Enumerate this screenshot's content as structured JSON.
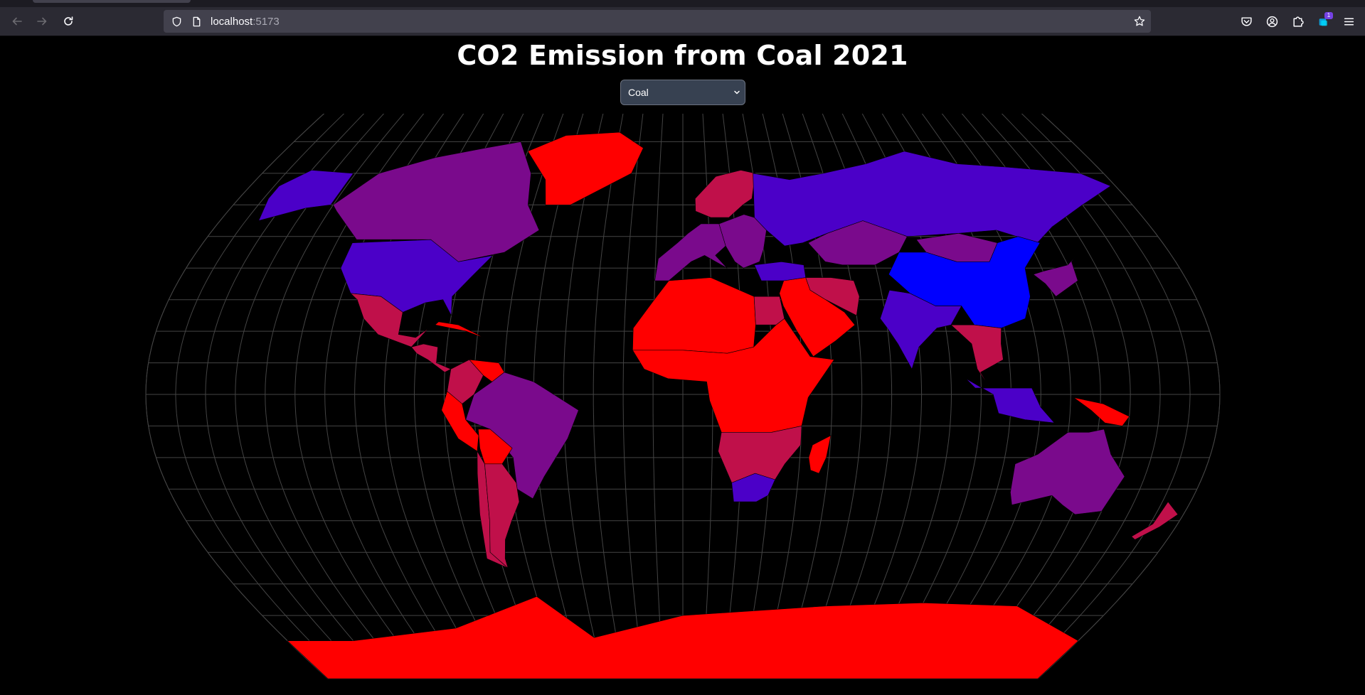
{
  "browser": {
    "url_host": "localhost",
    "url_port": ":5173",
    "extension_badge": "1",
    "icons": {
      "back": "arrow-left-icon",
      "forward": "arrow-right-icon",
      "reload": "reload-icon",
      "shield": "shield-icon",
      "page": "page-icon",
      "bookmark": "star-icon",
      "pocket": "pocket-icon",
      "account": "account-icon",
      "extensions": "puzzle-icon",
      "extension": "extension-icon",
      "menu": "hamburger-menu-icon"
    }
  },
  "page": {
    "title": "CO2 Emission from Coal 2021",
    "fuel_select": {
      "selected": "Coal"
    }
  },
  "map": {
    "projection": "robinson-like",
    "graticule": true,
    "colors": {
      "background": "#000000",
      "graticule": "#444444",
      "border": "#000000",
      "high": "#0000ff",
      "upper_mid": "#4b00c8",
      "mid": "#7a0a8c",
      "lower_mid": "#c0104a",
      "low": "#ff0000"
    },
    "regions": [
      {
        "name": "Canada",
        "level": "mid"
      },
      {
        "name": "United States",
        "level": "upper_mid"
      },
      {
        "name": "Alaska",
        "level": "upper_mid"
      },
      {
        "name": "Greenland",
        "level": "low"
      },
      {
        "name": "Mexico",
        "level": "lower_mid"
      },
      {
        "name": "Central America",
        "level": "lower_mid"
      },
      {
        "name": "Caribbean",
        "level": "low"
      },
      {
        "name": "Colombia",
        "level": "lower_mid"
      },
      {
        "name": "Venezuela",
        "level": "low"
      },
      {
        "name": "Brazil",
        "level": "mid"
      },
      {
        "name": "Peru",
        "level": "low"
      },
      {
        "name": "Bolivia",
        "level": "low"
      },
      {
        "name": "Chile",
        "level": "lower_mid"
      },
      {
        "name": "Argentina",
        "level": "lower_mid"
      },
      {
        "name": "Western Europe",
        "level": "mid"
      },
      {
        "name": "Scandinavia",
        "level": "lower_mid"
      },
      {
        "name": "Eastern Europe",
        "level": "mid"
      },
      {
        "name": "Russia",
        "level": "upper_mid"
      },
      {
        "name": "Kazakhstan",
        "level": "mid"
      },
      {
        "name": "Mongolia",
        "level": "mid"
      },
      {
        "name": "China",
        "level": "high"
      },
      {
        "name": "India",
        "level": "upper_mid"
      },
      {
        "name": "Middle East",
        "level": "low"
      },
      {
        "name": "Iran",
        "level": "lower_mid"
      },
      {
        "name": "Turkey",
        "level": "upper_mid"
      },
      {
        "name": "Northern Africa",
        "level": "low"
      },
      {
        "name": "Egypt",
        "level": "lower_mid"
      },
      {
        "name": "Central Africa",
        "level": "low"
      },
      {
        "name": "Southern Africa",
        "level": "lower_mid"
      },
      {
        "name": "South Africa",
        "level": "upper_mid"
      },
      {
        "name": "Madagascar",
        "level": "low"
      },
      {
        "name": "Southeast Asia",
        "level": "lower_mid"
      },
      {
        "name": "Indonesia",
        "level": "upper_mid"
      },
      {
        "name": "Japan & Korea",
        "level": "mid"
      },
      {
        "name": "Papua New Guinea",
        "level": "low"
      },
      {
        "name": "Australia",
        "level": "mid"
      },
      {
        "name": "New Zealand",
        "level": "lower_mid"
      },
      {
        "name": "Antarctica",
        "level": "low"
      }
    ]
  }
}
